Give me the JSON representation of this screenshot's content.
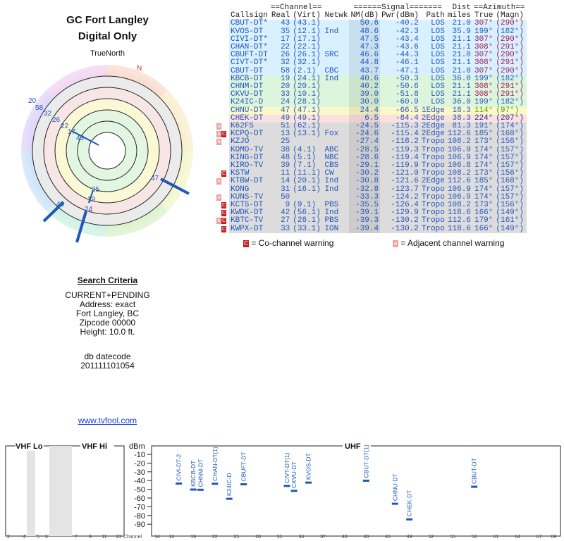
{
  "header": {
    "line1": "GC Fort Langley",
    "line2": "Digital Only"
  },
  "polar": {
    "north_label": "TrueNorth",
    "n_marker": "N",
    "labels": [
      "20",
      "58",
      "32",
      "26",
      "22",
      "17",
      "43",
      "47",
      "35",
      "19",
      "49",
      "24"
    ]
  },
  "criteria": {
    "title": "Search Criteria",
    "lines": [
      "CURRENT+PENDING",
      "Address: exact",
      "Fort Langley, BC",
      "Zipcode 00000",
      "Height: 10.0 ft."
    ],
    "db_label": "db datecode",
    "db_value": "201111101054",
    "link": "www.tvfool.com"
  },
  "table": {
    "group_channel": "==Channel==",
    "group_signal": "======Signal=======",
    "group_dist": "Dist",
    "group_azimuth": "==Azimuth==",
    "col_callsign": "Callsign",
    "col_real": "Real",
    "col_virt": "(Virt)",
    "col_netwk": "Netwk",
    "col_nm": "NM(dB)",
    "col_pwr": "Pwr(dBm)",
    "col_path": "Path",
    "col_miles": "miles",
    "col_true": "True",
    "col_magn": "(Magn)",
    "rows": [
      {
        "call": "CBUT-DT*",
        "real": "43",
        "virt": "(43.1)",
        "net": "",
        "nm": "50.6",
        "pwr": "-40.2",
        "path": "LOS",
        "dist": "21.0",
        "t": "307°",
        "m": "(290°)",
        "bg": "#d8f0ff",
        "c": "#2255c0",
        "ac": "#a01a55",
        "w": ""
      },
      {
        "call": "KVOS-DT",
        "real": "35",
        "virt": "(12.1)",
        "net": "Ind",
        "nm": "48.6",
        "pwr": "-42.3",
        "path": "LOS",
        "dist": "35.9",
        "t": "199°",
        "m": "(182°)",
        "bg": "#d8f0ff",
        "c": "#2255c0",
        "ac": "#2255c0",
        "w": ""
      },
      {
        "call": "CIVI-DT*",
        "real": "17",
        "virt": "(17.1)",
        "net": "",
        "nm": "47.5",
        "pwr": "-43.4",
        "path": "LOS",
        "dist": "21.1",
        "t": "307°",
        "m": "(290°)",
        "bg": "#d8f0ff",
        "c": "#2255c0",
        "ac": "#a01a55",
        "w": ""
      },
      {
        "call": "CHAN-DT*",
        "real": "22",
        "virt": "(22.1)",
        "net": "",
        "nm": "47.3",
        "pwr": "-43.6",
        "path": "LOS",
        "dist": "21.1",
        "t": "308°",
        "m": "(291°)",
        "bg": "#d8f0ff",
        "c": "#2255c0",
        "ac": "#a01a55",
        "w": ""
      },
      {
        "call": "CBUFT-DT",
        "real": "26",
        "virt": "(26.1)",
        "net": "SRC",
        "nm": "46.6",
        "pwr": "-44.3",
        "path": "LOS",
        "dist": "21.0",
        "t": "307°",
        "m": "(290°)",
        "bg": "#d8f0ff",
        "c": "#2255c0",
        "ac": "#a01a55",
        "w": ""
      },
      {
        "call": "CIVT-DT*",
        "real": "32",
        "virt": "(32.1)",
        "net": "",
        "nm": "44.8",
        "pwr": "-46.1",
        "path": "LOS",
        "dist": "21.1",
        "t": "308°",
        "m": "(291°)",
        "bg": "#d8f0ff",
        "c": "#2255c0",
        "ac": "#a01a55",
        "w": ""
      },
      {
        "call": "CBUT-DT",
        "real": "58",
        "virt": "(2.1)",
        "net": "CBC",
        "nm": "43.7",
        "pwr": "-47.1",
        "path": "LOS",
        "dist": "21.0",
        "t": "307°",
        "m": "(290°)",
        "bg": "#d8f0ff",
        "c": "#2255c0",
        "ac": "#a01a55",
        "w": ""
      },
      {
        "call": "KBCB-DT",
        "real": "19",
        "virt": "(24.1)",
        "net": "Ind",
        "nm": "40.6",
        "pwr": "-50.3",
        "path": "LOS",
        "dist": "36.0",
        "t": "199°",
        "m": "(182°)",
        "bg": "#dcf5dc",
        "c": "#2255c0",
        "ac": "#2255c0",
        "w": ""
      },
      {
        "call": "CHNM-DT",
        "real": "20",
        "virt": "(20.1)",
        "net": "",
        "nm": "40.2",
        "pwr": "-50.6",
        "path": "LOS",
        "dist": "21.1",
        "t": "308°",
        "m": "(291°)",
        "bg": "#dcf5dc",
        "c": "#2255c0",
        "ac": "#a01a55",
        "w": ""
      },
      {
        "call": "CKVU-DT",
        "real": "33",
        "virt": "(10.1)",
        "net": "",
        "nm": "39.0",
        "pwr": "-51.8",
        "path": "LOS",
        "dist": "21.1",
        "t": "308°",
        "m": "(291°)",
        "bg": "#dcf5dc",
        "c": "#2255c0",
        "ac": "#a01a55",
        "w": ""
      },
      {
        "call": "K24IC-D",
        "real": "24",
        "virt": "(28.1)",
        "net": "",
        "nm": "30.0",
        "pwr": "-60.9",
        "path": "LOS",
        "dist": "36.0",
        "t": "199°",
        "m": "(182°)",
        "bg": "#dcf5dc",
        "c": "#2255c0",
        "ac": "#2255c0",
        "w": ""
      },
      {
        "call": "CHNU-DT",
        "real": "47",
        "virt": "(47.1)",
        "net": "",
        "nm": "24.4",
        "pwr": "-66.5",
        "path": "1Edge",
        "dist": "18.3",
        "t": "114°",
        "m": "(97°)",
        "bg": "#fbf8c8",
        "c": "#2255c0",
        "ac": "#50a000",
        "w": ""
      },
      {
        "call": "CHEK-DT",
        "real": "49",
        "virt": "(49.1)",
        "net": "",
        "nm": "6.5",
        "pwr": "-84.4",
        "path": "2Edge",
        "dist": "38.3",
        "t": "224°",
        "m": "(207°)",
        "bg": "#fbe0e0",
        "c": "#2255c0",
        "ac": "#2a2a90",
        "w": ""
      },
      {
        "call": "K62FS",
        "real": "51",
        "virt": "(62.1)",
        "net": "",
        "nm": "-24.5",
        "pwr": "-115.3",
        "path": "2Edge",
        "dist": "81.3",
        "t": "191°",
        "m": "(174°)",
        "bg": "#dcdcdc",
        "c": "#2255c0",
        "ac": "#2255c0",
        "w": "a"
      },
      {
        "call": "KCPQ-DT",
        "real": "13",
        "virt": "(13.1)",
        "net": "Fox",
        "nm": "-24.6",
        "pwr": "-115.4",
        "path": "2Edge",
        "dist": "112.6",
        "t": "185°",
        "m": "(168°)",
        "bg": "#dcdcdc",
        "c": "#2255c0",
        "ac": "#2255c0",
        "w": "ac"
      },
      {
        "call": "KZJO",
        "real": "25",
        "virt": "",
        "net": "",
        "nm": "-27.4",
        "pwr": "-118.2",
        "path": "Tropo",
        "dist": "108.2",
        "t": "173°",
        "m": "(156°)",
        "bg": "#dcdcdc",
        "c": "#2255c0",
        "ac": "#2255c0",
        "w": "a"
      },
      {
        "call": "KOMO-TV",
        "real": "38",
        "virt": "(4.1)",
        "net": "ABC",
        "nm": "-28.5",
        "pwr": "-119.3",
        "path": "Tropo",
        "dist": "106.9",
        "t": "174°",
        "m": "(157°)",
        "bg": "#dcdcdc",
        "c": "#2255c0",
        "ac": "#2255c0",
        "w": ""
      },
      {
        "call": "KING-DT",
        "real": "48",
        "virt": "(5.1)",
        "net": "NBC",
        "nm": "-28.6",
        "pwr": "-119.4",
        "path": "Tropo",
        "dist": "106.9",
        "t": "174°",
        "m": "(157°)",
        "bg": "#dcdcdc",
        "c": "#2255c0",
        "ac": "#2255c0",
        "w": ""
      },
      {
        "call": "KIRO-TV",
        "real": "39",
        "virt": "(7.1)",
        "net": "CBS",
        "nm": "-29.1",
        "pwr": "-119.9",
        "path": "Tropo",
        "dist": "106.8",
        "t": "174°",
        "m": "(157°)",
        "bg": "#dcdcdc",
        "c": "#2255c0",
        "ac": "#2255c0",
        "w": ""
      },
      {
        "call": "KSTW",
        "real": "11",
        "virt": "(11.1)",
        "net": "CW",
        "nm": "-30.2",
        "pwr": "-121.0",
        "path": "Tropo",
        "dist": "108.2",
        "t": "173°",
        "m": "(156°)",
        "bg": "#dcdcdc",
        "c": "#2255c0",
        "ac": "#2255c0",
        "w": "c"
      },
      {
        "call": "KTBW-DT",
        "real": "14",
        "virt": "(20.1)",
        "net": "Ind",
        "nm": "-30.8",
        "pwr": "-121.6",
        "path": "2Edge",
        "dist": "112.6",
        "t": "185°",
        "m": "(168°)",
        "bg": "#dcdcdc",
        "c": "#2255c0",
        "ac": "#2255c0",
        "w": "a"
      },
      {
        "call": "KONG",
        "real": "31",
        "virt": "(16.1)",
        "net": "Ind",
        "nm": "-32.8",
        "pwr": "-123.7",
        "path": "Tropo",
        "dist": "106.9",
        "t": "174°",
        "m": "(157°)",
        "bg": "#dcdcdc",
        "c": "#2255c0",
        "ac": "#2255c0",
        "w": ""
      },
      {
        "call": "KUNS-TV",
        "real": "50",
        "virt": "",
        "net": "",
        "nm": "-33.3",
        "pwr": "-124.2",
        "path": "Tropo",
        "dist": "106.9",
        "t": "174°",
        "m": "(157°)",
        "bg": "#dcdcdc",
        "c": "#2255c0",
        "ac": "#2255c0",
        "w": "a"
      },
      {
        "call": "KCTS-DT",
        "real": "9",
        "virt": "(9.1)",
        "net": "PBS",
        "nm": "-35.5",
        "pwr": "-126.4",
        "path": "Tropo",
        "dist": "108.2",
        "t": "173°",
        "m": "(156°)",
        "bg": "#dcdcdc",
        "c": "#2255c0",
        "ac": "#2255c0",
        "w": "c"
      },
      {
        "call": "KWDK-DT",
        "real": "42",
        "virt": "(56.1)",
        "net": "Ind",
        "nm": "-39.1",
        "pwr": "-129.9",
        "path": "Tropo",
        "dist": "118.6",
        "t": "166°",
        "m": "(149°)",
        "bg": "#dcdcdc",
        "c": "#2255c0",
        "ac": "#2255c0",
        "w": "c"
      },
      {
        "call": "KBTC-TV",
        "real": "27",
        "virt": "(28.1)",
        "net": "PBS",
        "nm": "-39.3",
        "pwr": "-130.2",
        "path": "Tropo",
        "dist": "112.6",
        "t": "179°",
        "m": "(161°)",
        "bg": "#dcdcdc",
        "c": "#2255c0",
        "ac": "#2255c0",
        "w": "ac"
      },
      {
        "call": "KWPX-DT",
        "real": "33",
        "virt": "(33.1)",
        "net": "ION",
        "nm": "-39.4",
        "pwr": "-130.2",
        "path": "Tropo",
        "dist": "118.6",
        "t": "166°",
        "m": "(149°)",
        "bg": "#dcdcdc",
        "c": "#2255c0",
        "ac": "#2255c0",
        "w": "c"
      }
    ]
  },
  "legend": {
    "co_icon": "C",
    "co": " = Co-channel warning",
    "adj_icon": "a",
    "adj": " = Adjacent channel warning"
  },
  "spectrum": {
    "vhf_lo": "VHF Lo",
    "vhf_hi": "VHF Hi",
    "uhf": "UHF",
    "dbm": "dBm",
    "channel_label": "Channel",
    "y_ticks": [
      "-10",
      "-20",
      "-30",
      "-40",
      "-50",
      "-60",
      "-70",
      "-80",
      "-90"
    ],
    "vhf_ticks": [
      "2",
      "4",
      "5",
      "6",
      "7",
      "9",
      "11",
      "13"
    ],
    "uhf_ticks": [
      "14",
      "16",
      "19",
      "22",
      "25",
      "28",
      "31",
      "34",
      "37",
      "40",
      "43",
      "46",
      "49",
      "52",
      "55",
      "58",
      "61",
      "64",
      "67",
      "69"
    ],
    "stations": [
      {
        "name": "CIVI-DT-2",
        "ch": 17,
        "dbm": -43.4
      },
      {
        "name": "KBCB-DT",
        "ch": 19,
        "dbm": -50.3
      },
      {
        "name": "CHNM-DT",
        "ch": 20,
        "dbm": -50.6
      },
      {
        "name": "CHAN-DT(1)",
        "ch": 22,
        "dbm": -43.6
      },
      {
        "name": "K24IC-D",
        "ch": 24,
        "dbm": -60.9
      },
      {
        "name": "CBUFT-DT",
        "ch": 26,
        "dbm": -44.3
      },
      {
        "name": "CIVT-DT(1)",
        "ch": 32,
        "dbm": -46.1
      },
      {
        "name": "CKVU-DT",
        "ch": 33,
        "dbm": -51.8
      },
      {
        "name": "KVOS-DT",
        "ch": 35,
        "dbm": -42.3
      },
      {
        "name": "CBUT-DT(1)",
        "ch": 43,
        "dbm": -40.2
      },
      {
        "name": "CHNU-DT",
        "ch": 47,
        "dbm": -66.5
      },
      {
        "name": "CHEK-DT",
        "ch": 49,
        "dbm": -84.4
      },
      {
        "name": "CBUT-DT",
        "ch": 58,
        "dbm": -47.1
      }
    ]
  }
}
